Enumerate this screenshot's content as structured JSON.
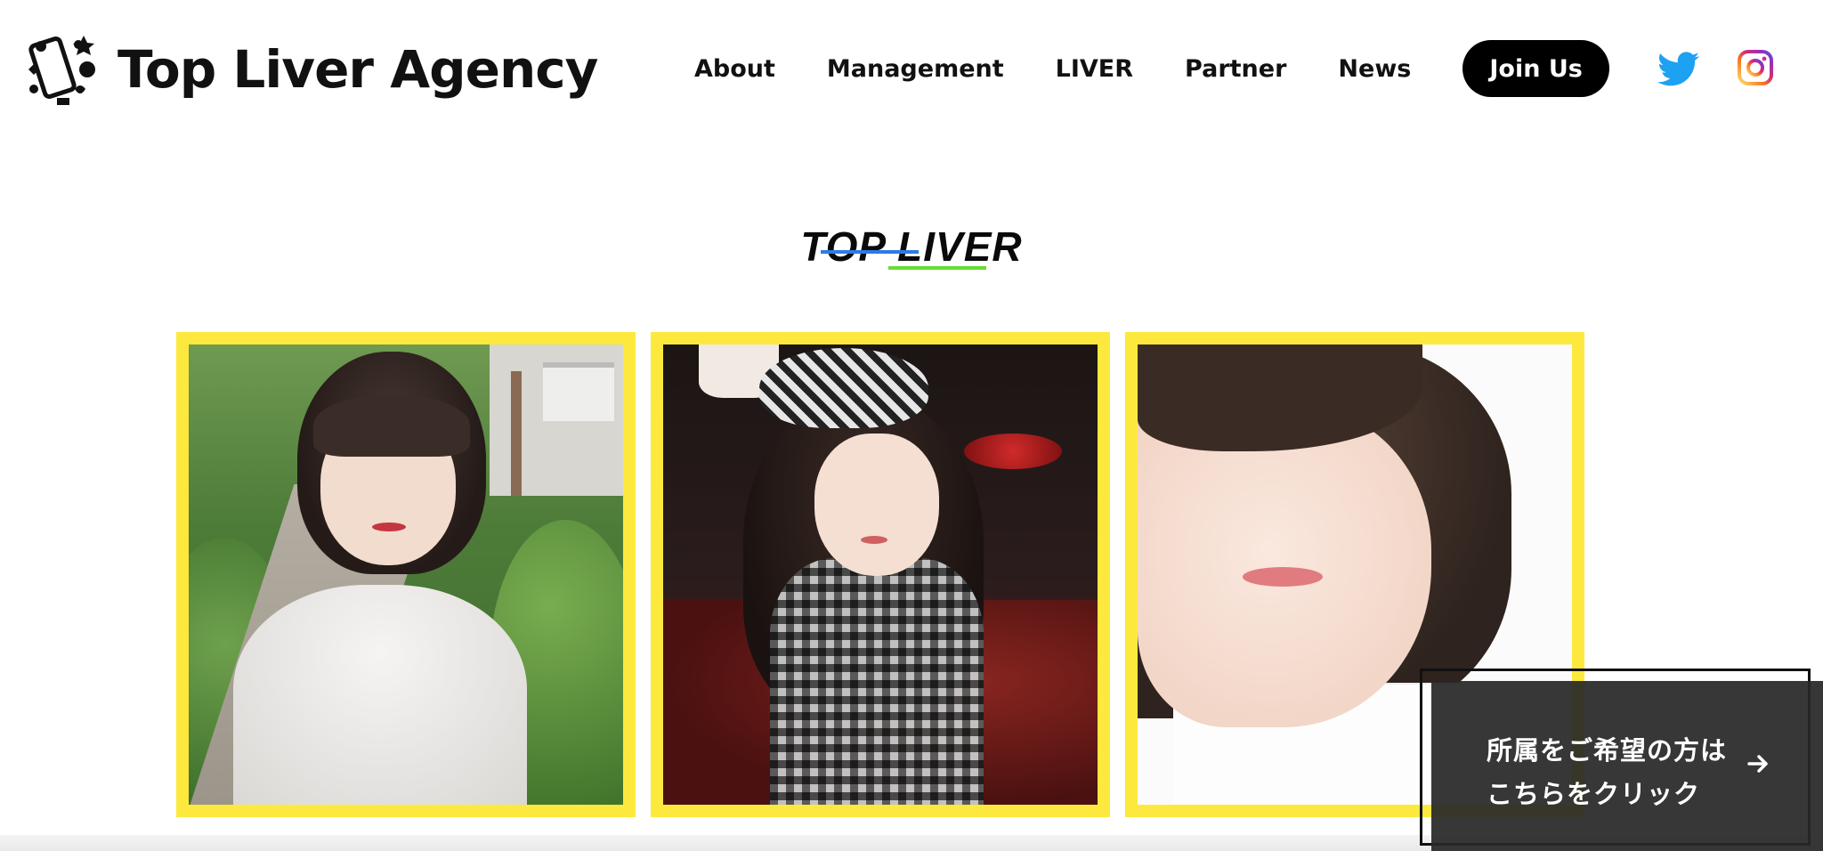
{
  "header": {
    "logo_text": "Top Liver Agency",
    "nav": [
      {
        "label": "About"
      },
      {
        "label": "Management"
      },
      {
        "label": "LIVER"
      },
      {
        "label": "Partner"
      },
      {
        "label": "News"
      }
    ],
    "join_label": "Join Us",
    "social": [
      "twitter-icon",
      "instagram-icon"
    ]
  },
  "section": {
    "title": "TOP LIVER",
    "accent_blue": "#2d7be5",
    "accent_green": "#66dd33"
  },
  "cards": {
    "frame_color": "#fde93e",
    "items": [
      {
        "image": "liver-photo-garden"
      },
      {
        "image": "liver-photo-gingham"
      },
      {
        "image": "liver-photo-smile"
      }
    ]
  },
  "cta": {
    "line1": "所属をご希望の方は",
    "line2": "こちらをクリック",
    "icon": "arrow-right-icon"
  }
}
